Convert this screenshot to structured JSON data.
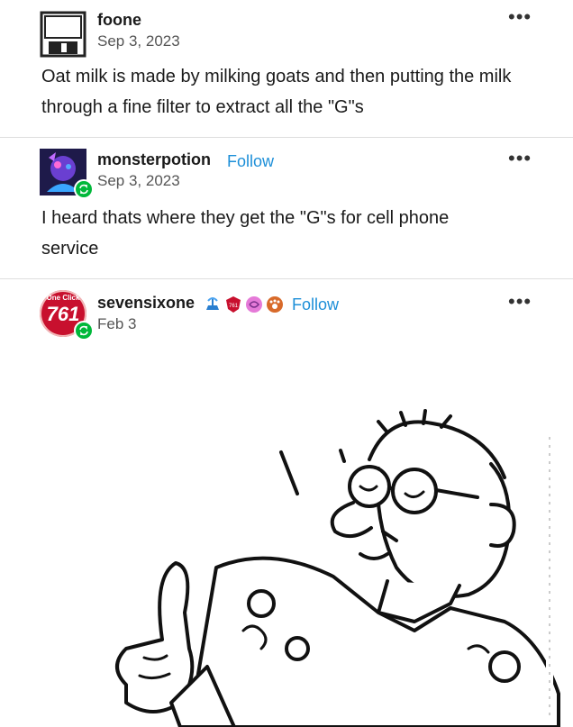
{
  "posts": [
    {
      "username": "foone",
      "date": "Sep 3, 2023",
      "body": "Oat milk is made by milking goats and then putting the milk through a fine filter to extract all the \"G\"s",
      "more_icon": "more-dots-icon"
    },
    {
      "username": "monsterpotion",
      "follow_label": "Follow",
      "date": "Sep 3, 2023",
      "body": "I heard thats where they get the \"G\"s for cell phone service",
      "more_icon": "more-dots-icon"
    },
    {
      "username": "sevensixone",
      "follow_label": "Follow",
      "date": "Feb 3",
      "avatar_text_top": "One Click",
      "avatar_text_main": "761",
      "badges": [
        "blue-fountain-badge-icon",
        "red-shield-badge-icon",
        "pink-brain-badge-icon",
        "orange-paw-badge-icon"
      ],
      "more_icon": "more-dots-icon"
    }
  ],
  "colors": {
    "follow": "#1d8fd8",
    "reblog": "#00b83a",
    "divider": "#dedede"
  }
}
